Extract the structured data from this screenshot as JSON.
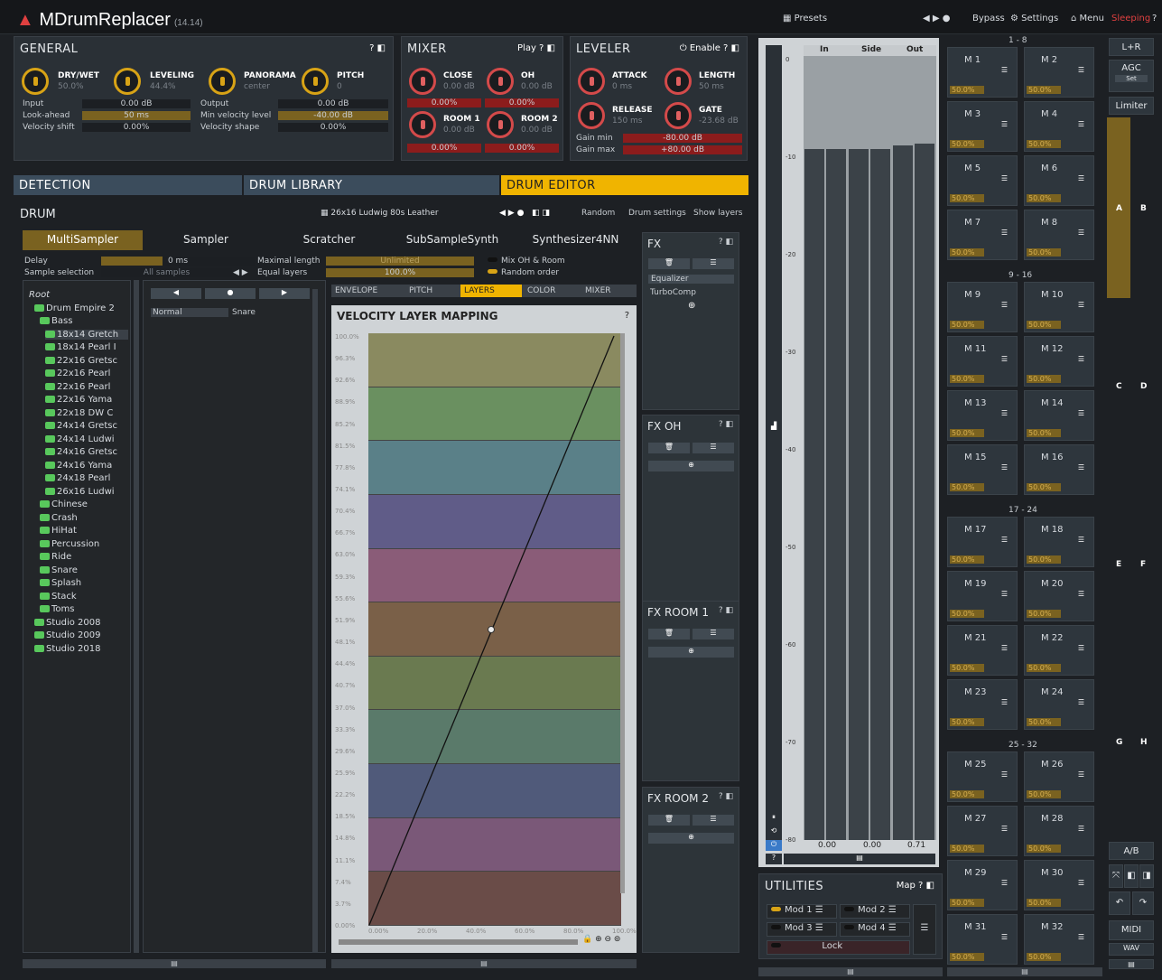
{
  "app": {
    "title": "MDrumReplacer",
    "version": "(14.14)",
    "presets": "Presets",
    "bypass": "Bypass",
    "settings": "Settings",
    "menu": "Menu",
    "sleeping": "Sleeping",
    "help": "?"
  },
  "general": {
    "title": "GENERAL",
    "knobs": [
      {
        "label": "DRY/WET",
        "value": "50.0%"
      },
      {
        "label": "LEVELING",
        "value": "44.4%"
      },
      {
        "label": "PANORAMA",
        "value": "center"
      },
      {
        "label": "PITCH",
        "value": "0"
      }
    ],
    "rows": [
      {
        "label": "Input",
        "value": "0.00 dB"
      },
      {
        "label": "Look-ahead",
        "value": "50 ms"
      },
      {
        "label": "Velocity shift",
        "value": "0.00%"
      },
      {
        "label": "Output",
        "value": "0.00 dB"
      },
      {
        "label": "Min velocity level",
        "value": "-40.00 dB"
      },
      {
        "label": "Velocity shape",
        "value": "0.00%"
      }
    ]
  },
  "mixer": {
    "title": "MIXER",
    "play": "Play",
    "knobs": [
      {
        "label": "CLOSE",
        "value": "0.00 dB",
        "pct": "0.00%"
      },
      {
        "label": "OH",
        "value": "0.00 dB",
        "pct": "0.00%"
      },
      {
        "label": "ROOM 1",
        "value": "0.00 dB",
        "pct": "0.00%"
      },
      {
        "label": "ROOM 2",
        "value": "0.00 dB",
        "pct": "0.00%"
      }
    ]
  },
  "leveler": {
    "title": "LEVELER",
    "enable": "Enable",
    "knobs": [
      {
        "label": "ATTACK",
        "value": "0 ms"
      },
      {
        "label": "LENGTH",
        "value": "50 ms"
      },
      {
        "label": "RELEASE",
        "value": "150 ms"
      },
      {
        "label": "GATE",
        "value": "-23.68 dB"
      }
    ],
    "gain_min_label": "Gain min",
    "gain_min": "-80.00 dB",
    "gain_max_label": "Gain max",
    "gain_max": "+80.00 dB"
  },
  "tabs": {
    "detection": "DETECTION",
    "library": "DRUM LIBRARY",
    "editor": "DRUM EDITOR"
  },
  "drum": {
    "title": "DRUM",
    "preset": "26x16 Ludwig 80s Leather",
    "random": "Random",
    "settings": "Drum settings",
    "layers": "Show layers"
  },
  "engines": [
    "MultiSampler",
    "Sampler",
    "Scratcher",
    "SubSampleSynth",
    "Synthesizer4NN"
  ],
  "params": {
    "delay_label": "Delay",
    "delay": "0 ms",
    "sel_label": "Sample selection",
    "sel": "All samples",
    "maxlen_label": "Maximal length",
    "maxlen": "Unlimited",
    "eq_label": "Equal layers",
    "eq": "100.0%",
    "mix_label": "Mix OH & Room",
    "rand_label": "Random order"
  },
  "tree": [
    "Root",
    "Drum Empire 2",
    "Bass",
    "18x14 Gretch",
    "18x14 Pearl I",
    "22x16 Gretsc",
    "22x16 Pearl",
    "22x16 Pearl",
    "22x16 Yama",
    "22x18 DW C",
    "24x14 Gretsc",
    "24x14 Ludwi",
    "24x16 Gretsc",
    "24x16 Yama",
    "24x18 Pearl",
    "26x16 Ludwi",
    "Chinese",
    "Crash",
    "HiHat",
    "Percussion",
    "Ride",
    "Snare",
    "Splash",
    "Stack",
    "Toms",
    "Studio 2008",
    "Studio 2009",
    "Studio 2018"
  ],
  "layer": {
    "mode": "Normal",
    "name": "Snare"
  },
  "edtabs": [
    "ENVELOPE",
    "PITCH",
    "LAYERS",
    "COLOR",
    "MIXER"
  ],
  "vlm": {
    "title": "VELOCITY LAYER MAPPING",
    "yticks": [
      "100.0%",
      "96.3%",
      "92.6%",
      "88.9%",
      "85.2%",
      "81.5%",
      "77.8%",
      "74.1%",
      "70.4%",
      "66.7%",
      "63.0%",
      "59.3%",
      "55.6%",
      "51.9%",
      "48.1%",
      "44.4%",
      "40.7%",
      "37.0%",
      "33.3%",
      "29.6%",
      "25.9%",
      "22.2%",
      "18.5%",
      "14.8%",
      "11.1%",
      "7.4%",
      "3.7%",
      "0.00%"
    ],
    "xticks": [
      "0.00%",
      "20.0%",
      "40.0%",
      "60.0%",
      "80.0%",
      "100.0%"
    ],
    "colors": [
      "#8a8a60",
      "#6a9060",
      "#5a8088",
      "#605c88",
      "#8a5c78",
      "#7a6048",
      "#6a7a50",
      "#5a7a6a",
      "#505a7a",
      "#7a5878",
      "#6a4c48"
    ]
  },
  "fx": {
    "title": "FX",
    "items": [
      "Equalizer",
      "TurboComp"
    ]
  },
  "fxoh": {
    "title": "FX OH"
  },
  "fxr1": {
    "title": "FX ROOM 1"
  },
  "fxr2": {
    "title": "FX ROOM 2"
  },
  "meter": {
    "labels": [
      "In",
      "Side",
      "Out"
    ],
    "scale": [
      "0",
      "-10",
      "-20",
      "-30",
      "-40",
      "-50",
      "-60",
      "-70",
      "-80"
    ],
    "values": [
      "0.00",
      "0.00",
      "0.71"
    ]
  },
  "utilities": {
    "title": "UTILITIES",
    "map": "Map",
    "mods": [
      "Mod 1",
      "Mod 2",
      "Mod 3",
      "Mod 4"
    ],
    "lock": "Lock"
  },
  "mods": {
    "groups": [
      "1 - 8",
      "9 - 16",
      "17 - 24",
      "25 - 32"
    ],
    "items": [
      "M 1",
      "M 2",
      "M 3",
      "M 4",
      "M 5",
      "M 6",
      "M 7",
      "M 8",
      "M 9",
      "M 10",
      "M 11",
      "M 12",
      "M 13",
      "M 14",
      "M 15",
      "M 16",
      "M 17",
      "M 18",
      "M 19",
      "M 20",
      "M 21",
      "M 22",
      "M 23",
      "M 24",
      "M 25",
      "M 26",
      "M 27",
      "M 28",
      "M 29",
      "M 30",
      "M 31",
      "M 32"
    ],
    "value": "50.0%"
  },
  "right": {
    "lr": "L+R",
    "agc": "AGC",
    "set": "Set",
    "limiter": "Limiter",
    "ab": "A/B",
    "midi": "MIDI",
    "wav": "WAV",
    "letters": [
      "A",
      "B",
      "C",
      "D",
      "E",
      "F",
      "G",
      "H"
    ]
  }
}
